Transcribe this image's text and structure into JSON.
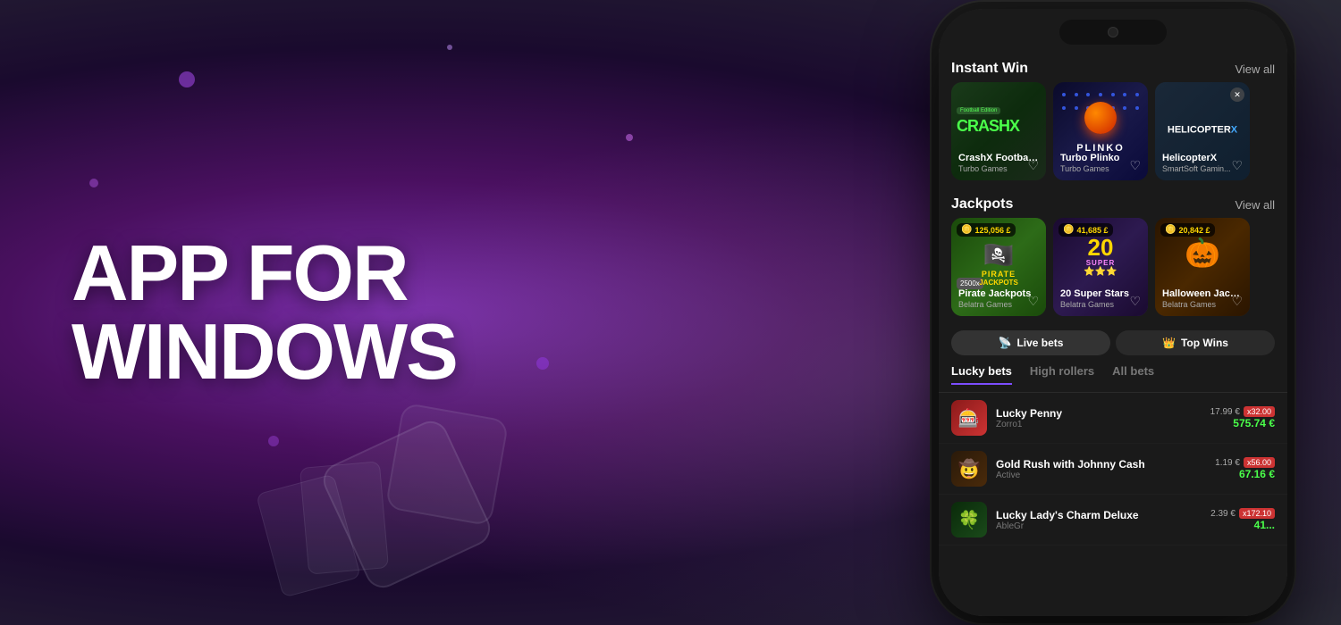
{
  "background": {
    "theme": "purple-dark"
  },
  "hero": {
    "line1": "APP FOR",
    "line2": "WINDOWS"
  },
  "phone": {
    "instant_win": {
      "section_title": "Instant Win",
      "view_all": "View all",
      "games": [
        {
          "id": "crashx",
          "name": "CrashX Football E...",
          "provider": "Turbo Games",
          "badge": "Football Edition",
          "logo": "CRASH",
          "logo_suffix": "X",
          "color_theme": "green-dark"
        },
        {
          "id": "plinko",
          "name": "Turbo Plinko",
          "provider": "Turbo Games",
          "color_theme": "blue-dark"
        },
        {
          "id": "helicopterx",
          "name": "HelicopterX",
          "provider": "SmartSoft Gamin...",
          "color_theme": "teal-dark"
        }
      ]
    },
    "jackpots": {
      "section_title": "Jackpots",
      "view_all": "View all",
      "games": [
        {
          "id": "pirate",
          "name": "Pirate Jackpots",
          "provider": "Belatra Games",
          "amount": "125,056 £",
          "multiplier": "2500x",
          "color_theme": "green-jungle"
        },
        {
          "id": "superstars",
          "name": "20 Super Stars",
          "provider": "Belatra Games",
          "amount": "41,685 £",
          "color_theme": "purple-stars"
        },
        {
          "id": "halloween",
          "name": "Halloween Jackp...",
          "provider": "Belatra Games",
          "amount": "20,842 £",
          "color_theme": "orange-dark"
        }
      ]
    },
    "live_bets_tab": "Live bets",
    "top_wins_tab": "Top Wins",
    "sub_tabs": [
      {
        "id": "lucky",
        "label": "Lucky bets",
        "active": true
      },
      {
        "id": "highrollers",
        "label": "High rollers",
        "active": false
      },
      {
        "id": "allbets",
        "label": "All bets",
        "active": false
      }
    ],
    "bets": [
      {
        "game": "Lucky Penny",
        "player": "Zorro1",
        "original_bet": "17.99 €",
        "multiplier": "x32.00",
        "win": "575.74 €",
        "thumb": "🎰",
        "thumb_class": "thumb-penny"
      },
      {
        "game": "Gold Rush with Johnny Cash",
        "player": "Active",
        "original_bet": "1.19 €",
        "multiplier": "x56.00",
        "win": "67.16 €",
        "thumb": "🤠",
        "thumb_class": "thumb-goldrush"
      },
      {
        "game": "Lucky Lady's Charm Deluxe",
        "player": "AbleGr",
        "original_bet": "2.39 €",
        "multiplier": "x172.10",
        "win": "41...",
        "thumb": "🍀",
        "thumb_class": "thumb-lucky"
      }
    ]
  }
}
